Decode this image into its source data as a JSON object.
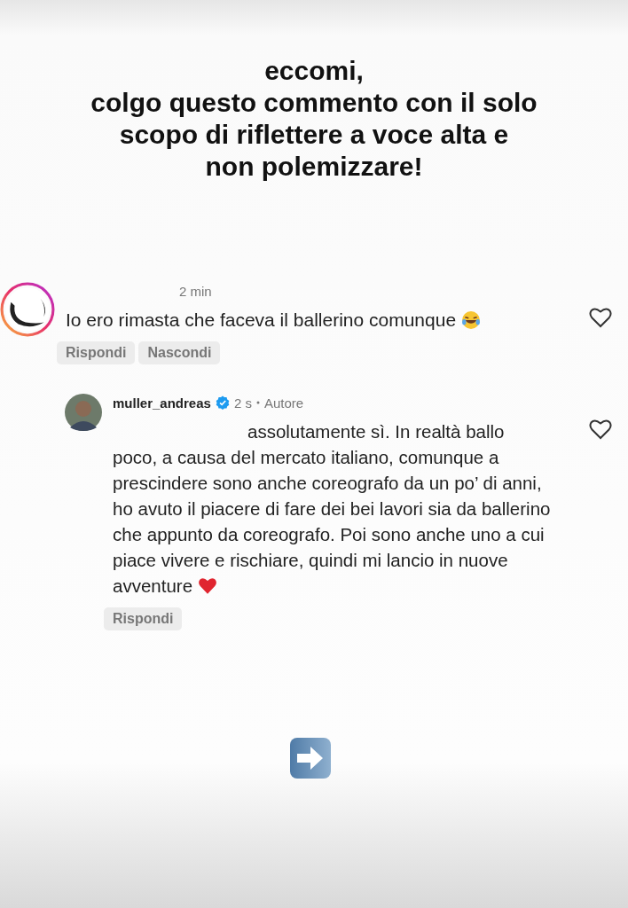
{
  "heading": [
    "eccomi,",
    "colgo questo commento con il solo",
    "scopo di riflettere a voce alta e",
    "non polemizzare!"
  ],
  "comments": [
    {
      "kind": "comment",
      "verified": false,
      "time": "2 min",
      "text": "Io ero rimasta che faceva il ballerino comunque",
      "liked": false,
      "actions": [
        "Rispondi",
        "Nascondi"
      ]
    },
    {
      "kind": "reply",
      "username": "muller_andreas",
      "verified": true,
      "time": "2 s",
      "author_label": "Autore",
      "text": "assolutamente sì. In realtà ballo poco, a causa del mercato italiano, comunque a prescindere sono anche coreografo da un po’ di anni, ho avuto il piacere di fare dei bei lavori sia da ballerino che appunto da coreografo. Poi sono anche uno a cui piace vivere e rischiare, quindi mi lancio in nuove avventure",
      "liked": false,
      "actions": [
        "Rispondi"
      ]
    }
  ]
}
